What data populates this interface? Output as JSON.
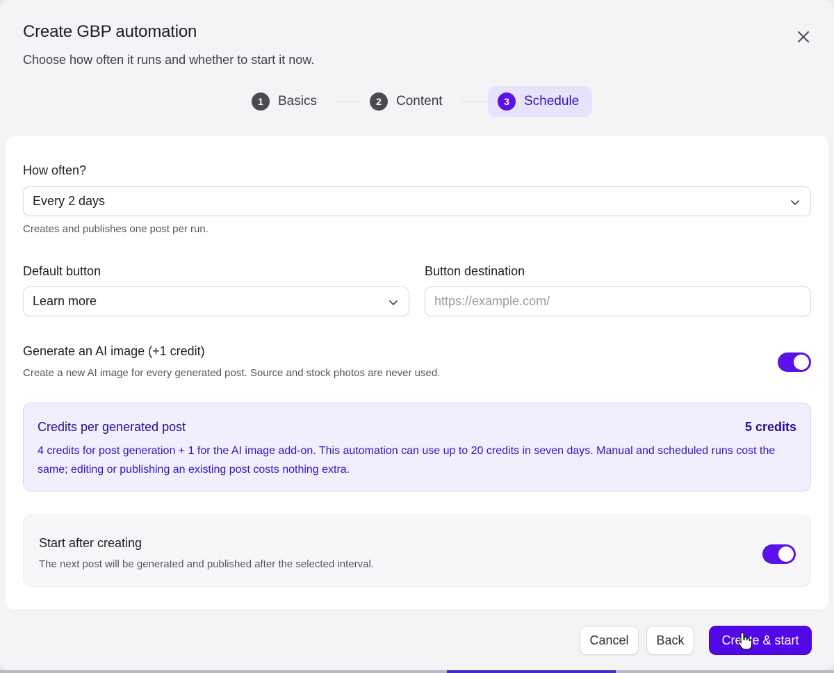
{
  "modal": {
    "title": "Create GBP automation",
    "subtitle": "Choose how often it runs and whether to start it now."
  },
  "icons": {
    "close": "close-icon",
    "chevron": "chevron-down-icon"
  },
  "steps": [
    {
      "number": "1",
      "label": "Basics",
      "active": false
    },
    {
      "number": "2",
      "label": "Content",
      "active": false
    },
    {
      "number": "3",
      "label": "Schedule",
      "active": true
    }
  ],
  "frequency": {
    "label": "How often?",
    "value": "Every 2 days",
    "help": "Creates and publishes one post per run."
  },
  "default_button": {
    "label": "Default button",
    "value": "Learn more"
  },
  "button_destination": {
    "label": "Button destination",
    "placeholder": "https://example.com/"
  },
  "ai_image": {
    "label": "Generate an AI image (+1 credit)",
    "help": "Create a new AI image for every generated post. Source and stock photos are never used.",
    "enabled": true
  },
  "credits": {
    "title": "Credits per generated post",
    "amount": "5 credits",
    "description": "4 credits for post generation + 1 for the AI image add-on. This automation can use up to 20 credits in seven days. Manual and scheduled runs cost the same; editing or publishing an existing post costs nothing extra."
  },
  "start_after": {
    "title": "Start after creating",
    "description": "The next post will be generated and published after the selected interval.",
    "enabled": true
  },
  "footer": {
    "cancel_label": "Cancel",
    "back_label": "Back",
    "submit_label": "Create & start"
  },
  "colors": {
    "accent": "#5b12e8",
    "credits_bg": "#f1eefe",
    "credits_text": "#3a12b8"
  }
}
